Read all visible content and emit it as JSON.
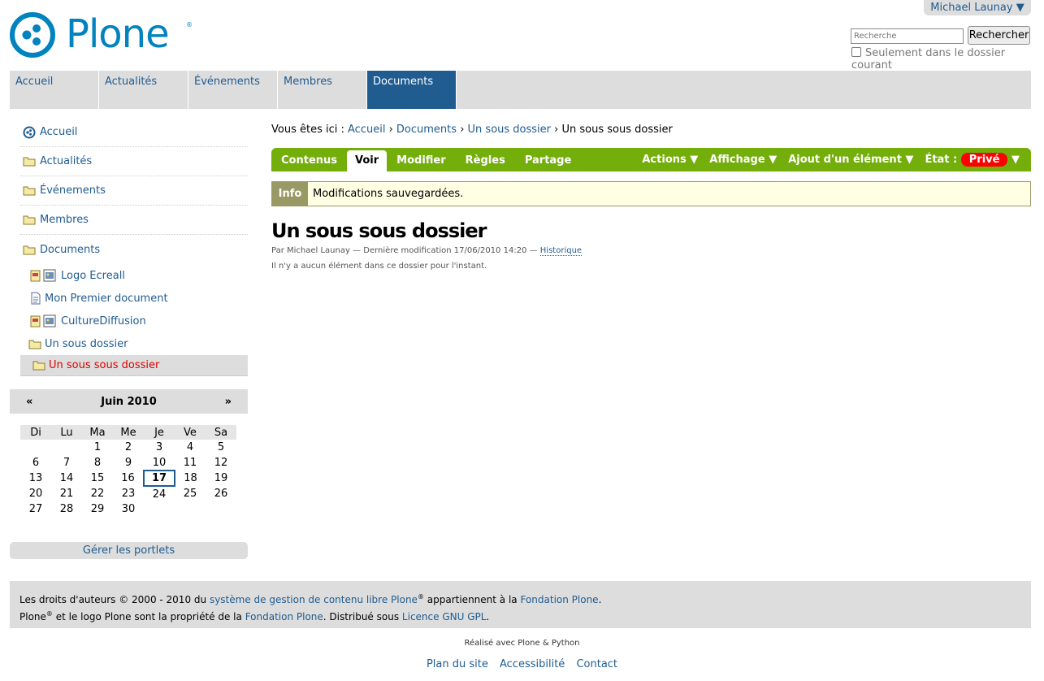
{
  "user_menu": {
    "label": "Michael Launay ▼"
  },
  "logo": {
    "text": "Plone",
    "registered": "®"
  },
  "search": {
    "placeholder": "Recherche",
    "button_label": "Rechercher",
    "scope_label": "Seulement dans le dossier courant"
  },
  "global_nav": [
    {
      "label": "Accueil"
    },
    {
      "label": "Actualités"
    },
    {
      "label": "Événements"
    },
    {
      "label": "Membres"
    },
    {
      "label": "Documents",
      "selected": true
    }
  ],
  "nav_portlet": {
    "items": [
      {
        "label": "Accueil",
        "icon": "plone-logo-icon"
      },
      {
        "label": "Actualités",
        "icon": "folder-icon"
      },
      {
        "label": "Événements",
        "icon": "folder-icon"
      },
      {
        "label": "Membres",
        "icon": "folder-icon"
      },
      {
        "label": "Documents",
        "icon": "folder-icon"
      }
    ],
    "sub_items": [
      {
        "label": "Logo Ecreall",
        "icon": "image-icon"
      },
      {
        "label": "Mon Premier document",
        "icon": "document-icon"
      },
      {
        "label": "CultureDiffusion",
        "icon": "image-icon"
      },
      {
        "label": "Un sous dossier",
        "icon": "folder-icon"
      },
      {
        "label": "Un sous sous dossier",
        "icon": "folder-icon",
        "current": true
      }
    ]
  },
  "calendar": {
    "prev": "«",
    "next": "»",
    "month_label": "Juin 2010",
    "weekdays": [
      "Di",
      "Lu",
      "Ma",
      "Me",
      "Je",
      "Ve",
      "Sa"
    ],
    "weeks": [
      [
        "",
        "",
        "1",
        "2",
        "3",
        "4",
        "5"
      ],
      [
        "6",
        "7",
        "8",
        "9",
        "10",
        "11",
        "12"
      ],
      [
        "13",
        "14",
        "15",
        "16",
        "17",
        "18",
        "19"
      ],
      [
        "20",
        "21",
        "22",
        "23",
        "24",
        "25",
        "26"
      ],
      [
        "27",
        "28",
        "29",
        "30",
        "",
        "",
        ""
      ]
    ],
    "today": "17"
  },
  "manage_portlets": "Gérer les portlets",
  "breadcrumb": {
    "prefix": "Vous êtes ici :",
    "items": [
      "Accueil",
      "Documents",
      "Un sous dossier"
    ],
    "separator": "›",
    "current": "Un sous sous dossier"
  },
  "content_views": {
    "tabs": [
      {
        "label": "Contenus"
      },
      {
        "label": "Voir",
        "selected": true
      },
      {
        "label": "Modifier"
      },
      {
        "label": "Règles"
      },
      {
        "label": "Partage"
      }
    ],
    "actions": [
      {
        "label": "Actions ▼"
      },
      {
        "label": "Affichage ▼"
      },
      {
        "label": "Ajout d'un élément ▼"
      }
    ],
    "state_prefix": "État :",
    "state_value": "Privé",
    "state_arrow": "▼"
  },
  "status_message": {
    "label": "Info",
    "text": "Modifications sauvegardées."
  },
  "page": {
    "title": "Un sous sous dossier",
    "byline_prefix": "Par Michael Launay — Dernière modification 17/06/2010 14:20 —",
    "history_link": "Historique",
    "empty_text": "Il n'y a aucun élément dans ce dossier pour l'instant."
  },
  "footer": {
    "line1_a": "Les droits d'auteurs © 2000 - 2010 du",
    "line1_link1": "système de gestion de contenu libre Plone",
    "line1_reg": "®",
    "line1_b": "appartiennent à la",
    "line1_link2": "Fondation Plone",
    "line1_c": ".",
    "line2_a": "Plone",
    "line2_reg": "®",
    "line2_b": "et le logo Plone sont la propriété de la",
    "line2_link1": "Fondation Plone",
    "line2_c": ". Distribué sous",
    "line2_link2": "Licence GNU GPL",
    "line2_d": "."
  },
  "colophon": "Réalisé avec Plone & Python",
  "site_actions": [
    "Plan du site",
    "Accessibilité",
    "Contact"
  ],
  "colors": {
    "brand_blue": "#0083be",
    "link_blue": "#205c90",
    "content_views_green": "#74ae0b",
    "state_red": "#ff0000"
  }
}
